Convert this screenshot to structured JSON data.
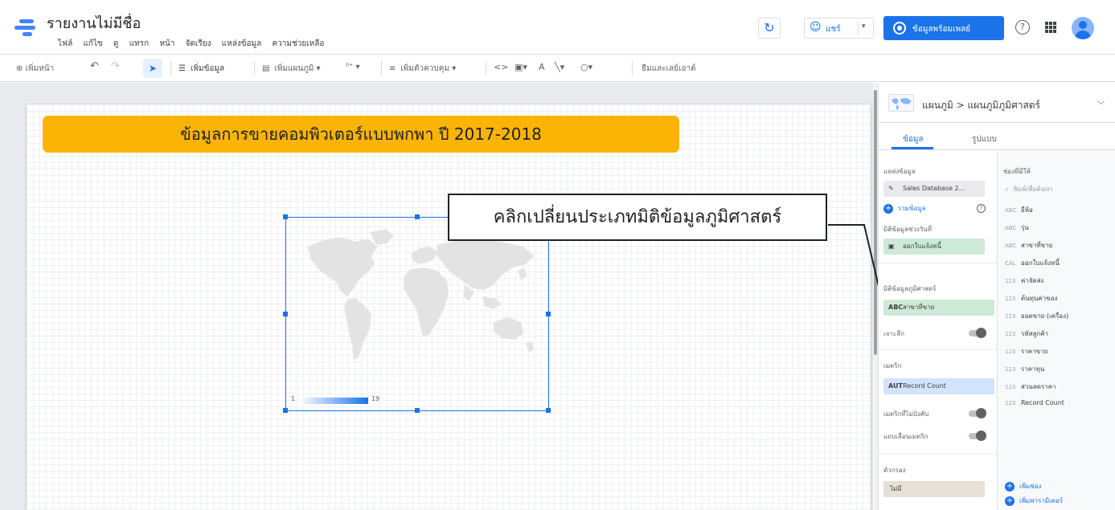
{
  "header": {
    "title": "รายงานไม่มีชื่อ",
    "menu": [
      "ไฟล์",
      "แก้ไข",
      "ดู",
      "แทรก",
      "หน้า",
      "จัดเรียง",
      "แหล่งข้อมูล",
      "ความช่วยเหลือ"
    ],
    "share_label": "แชร์",
    "view_label": "ข้อมูลพร้อมเพลย์",
    "refresh_icon": "refresh-icon",
    "help_glyph": "?",
    "share_dropdown": "▾"
  },
  "toolbar": {
    "add_page": "⊕ เพิ่มหน้า",
    "undo": "↶",
    "redo": "↷",
    "cursor": "➤",
    "add_data": "เพิ่มข้อมูล",
    "add_chart": "เพิ่มแผนภูมิ ▾",
    "community": "⁰⁺ ▾",
    "add_control": "เพิ่มตัวควบคุม ▾",
    "code": "<>",
    "image": "▣▾",
    "text": "A",
    "line": "╲▾",
    "shape": "○▾",
    "theme_layout": "ธีมและเลย์เอาต์"
  },
  "canvas": {
    "banner_title": "ข้อมูลการขายคอมพิวเตอร์แบบพกพา ปี 2017-2018",
    "legend_min": "1",
    "legend_max": "19",
    "callout_text": "คลิกเปลี่ยนประเภทมิติข้อมูลภูมิศาสตร์"
  },
  "panel": {
    "chart_type": "แผนภูมิ > แผนภูมิภูมิศาสตร์",
    "tabs": [
      "ข้อมูล",
      "รูปแบบ"
    ],
    "data_source_label": "แหล่งข้อมูล",
    "data_source_value": "Sales Database 2...",
    "blend_label": "รวมข้อมูล",
    "date_range_label": "มิติข้อมูลช่วงวันที่",
    "date_range_value": "ออกใบแจ้งหนี้",
    "geo_dimension_label": "มิติข้อมูลภูมิศาสตร์",
    "geo_dimension_value": "สาขาที่ขาย",
    "drill_down_label": "เจาะลึก",
    "metric_label": "เมตริก",
    "metric_value": "Record Count",
    "optional_metrics_label": "เมตริกที่ไม่บังคับ",
    "metric_slider_label": "แถบเลื่อนเมตริก",
    "filter_label": "ตัวกรอง",
    "filter_value": "ไม่มี",
    "available_fields_label": "ช่องที่มีให้",
    "search_placeholder": "พิมพ์เพื่อค้นหา",
    "fields": [
      {
        "type": "ABC",
        "name": "ยี่ห้อ"
      },
      {
        "type": "ABC",
        "name": "รุ่น"
      },
      {
        "type": "ABC",
        "name": "สาขาที่ขาย"
      },
      {
        "type": "CAL",
        "name": "ออกใบแจ้งหนี้"
      },
      {
        "type": "123",
        "name": "ค่าจัดส่ง"
      },
      {
        "type": "123",
        "name": "ต้นทุนค่าของ"
      },
      {
        "type": "123",
        "name": "ยอดขาย (เครื่อง)"
      },
      {
        "type": "123",
        "name": "รหัสลูกค้า"
      },
      {
        "type": "123",
        "name": "ราคาขาย"
      },
      {
        "type": "123",
        "name": "ราคาทุน"
      },
      {
        "type": "123",
        "name": "ส่วนลดราคา"
      },
      {
        "type": "123",
        "name": "Record Count"
      }
    ],
    "add_field": "เพิ่มช่อง",
    "add_parameter": "เพิ่มพารามิเตอร์"
  },
  "colors": {
    "accent": "#1a73e8",
    "banner": "#fbb404",
    "dimension_chip": "#ceead6",
    "metric_chip": "#d2e3fc"
  }
}
